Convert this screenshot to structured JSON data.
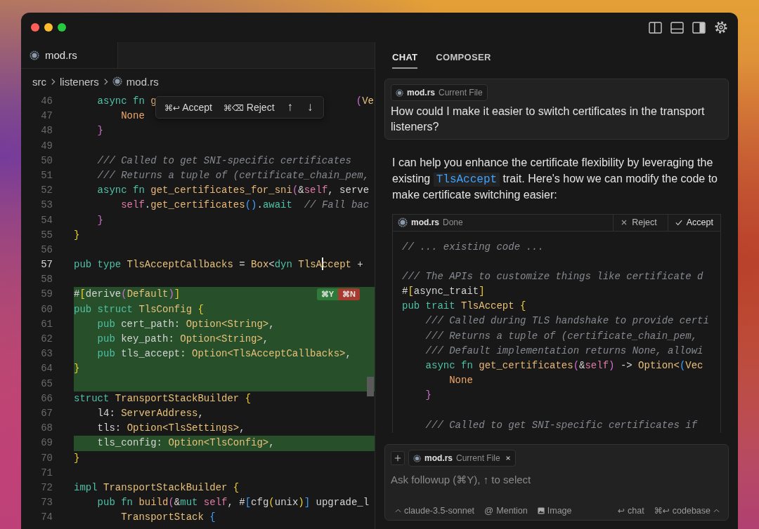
{
  "window": {
    "traffic_lights": [
      {
        "color": "#ff5f57"
      },
      {
        "color": "#febc2e"
      },
      {
        "color": "#28c840"
      }
    ]
  },
  "editor": {
    "tabs": [
      {
        "label": "mod.rs",
        "selected": true
      }
    ],
    "breadcrumb": [
      {
        "label": "src",
        "file": false
      },
      {
        "label": "listeners",
        "file": false
      },
      {
        "label": "mod.rs",
        "file": true
      }
    ],
    "popup": {
      "accept_keys": "⌘↩",
      "accept": "Accept",
      "reject_keys": "⌘⌫",
      "reject": "Reject",
      "previous": "↑",
      "next": "↓"
    },
    "lines": [
      {
        "n": "46",
        "added": false,
        "current": false,
        "tokens": [
          {
            "kind": "kw",
            "text": "    async fn"
          },
          {
            "kind": "fn",
            "text": " g"
          }
        ],
        "tail": [
          {
            "kind": "b2",
            "text": "("
          },
          {
            "kind": "type",
            "text": "Ve"
          }
        ]
      },
      {
        "n": "47",
        "added": false,
        "current": false,
        "tokens": [
          {
            "kind": "const",
            "text": "        None"
          }
        ]
      },
      {
        "n": "48",
        "added": false,
        "current": false,
        "tokens": [
          {
            "kind": "b2",
            "text": "    }"
          }
        ]
      },
      {
        "n": "49",
        "added": false,
        "current": false
      },
      {
        "n": "50",
        "added": false,
        "current": false,
        "tokens": [
          {
            "kind": "comment",
            "text": "    /// Called to get SNI-specific certificates"
          }
        ]
      },
      {
        "n": "51",
        "added": false,
        "current": false,
        "tokens": [
          {
            "kind": "comment",
            "text": "    /// Returns a tuple of (certificate_chain_pem,"
          }
        ]
      },
      {
        "n": "52",
        "added": false,
        "current": false,
        "tokens": [
          {
            "kind": "kw",
            "text": "    async fn"
          },
          {
            "kind": "fn",
            "text": " get_certificates_for_sni"
          },
          {
            "kind": "b2",
            "text": "("
          },
          {
            "kind": "p",
            "text": "&"
          },
          {
            "kind": "self",
            "text": "self"
          },
          {
            "kind": "p",
            "text": ", serve"
          }
        ]
      },
      {
        "n": "53",
        "added": false,
        "current": false,
        "tokens": [
          {
            "kind": "self",
            "text": "        self"
          },
          {
            "kind": "p",
            "text": "."
          },
          {
            "kind": "fn",
            "text": "get_certificates"
          },
          {
            "kind": "b3",
            "text": "()"
          },
          {
            "kind": "p",
            "text": "."
          },
          {
            "kind": "kw",
            "text": "await"
          },
          {
            "kind": "comment",
            "text": "  // Fall bac"
          }
        ]
      },
      {
        "n": "54",
        "added": false,
        "current": false,
        "tokens": [
          {
            "kind": "b2",
            "text": "    }"
          }
        ]
      },
      {
        "n": "55",
        "added": false,
        "current": false,
        "tokens": [
          {
            "kind": "b1",
            "text": "}"
          }
        ]
      },
      {
        "n": "56",
        "added": false,
        "current": false
      },
      {
        "n": "57",
        "added": false,
        "current": true,
        "tokens": [
          {
            "kind": "kw",
            "text": "pub type"
          },
          {
            "kind": "type",
            "text": " TlsAcceptCallbacks"
          },
          {
            "kind": "p",
            "text": " = "
          },
          {
            "kind": "type",
            "text": "Box"
          },
          {
            "kind": "p",
            "text": "<"
          },
          {
            "kind": "kw",
            "text": "dyn"
          },
          {
            "kind": "type",
            "text": " TlsA"
          },
          {
            "kind": "type",
            "text": "ccept",
            "cursor": true
          },
          {
            "kind": "p",
            "text": " +"
          }
        ]
      },
      {
        "n": "58",
        "added": false,
        "current": false
      },
      {
        "n": "59",
        "added": true,
        "current": false,
        "hunk_actions": {
          "accept": "⌘Y",
          "reject": "⌘N"
        },
        "tokens": [
          {
            "kind": "p",
            "text": "#"
          },
          {
            "kind": "b1",
            "text": "["
          },
          {
            "kind": "p",
            "text": "derive"
          },
          {
            "kind": "b2",
            "text": "("
          },
          {
            "kind": "type",
            "text": "Default"
          },
          {
            "kind": "b2",
            "text": ")"
          },
          {
            "kind": "b1",
            "text": "]"
          }
        ]
      },
      {
        "n": "60",
        "added": true,
        "current": false,
        "tokens": [
          {
            "kind": "kw",
            "text": "pub struct"
          },
          {
            "kind": "type",
            "text": " TlsConfig"
          },
          {
            "kind": "b1",
            "text": " {"
          }
        ]
      },
      {
        "n": "61",
        "added": true,
        "current": false,
        "tokens": [
          {
            "kind": "kw",
            "text": "    pub"
          },
          {
            "kind": "p",
            "text": " cert_path: "
          },
          {
            "kind": "type",
            "text": "Option<String>"
          },
          {
            "kind": "p",
            "text": ","
          }
        ]
      },
      {
        "n": "62",
        "added": true,
        "current": false,
        "tokens": [
          {
            "kind": "kw",
            "text": "    pub"
          },
          {
            "kind": "p",
            "text": " key_path: "
          },
          {
            "kind": "type",
            "text": "Option<String>"
          },
          {
            "kind": "p",
            "text": ","
          }
        ]
      },
      {
        "n": "63",
        "added": true,
        "current": false,
        "tokens": [
          {
            "kind": "kw",
            "text": "    pub"
          },
          {
            "kind": "p",
            "text": " tls_accept: "
          },
          {
            "kind": "type",
            "text": "Option<TlsAcceptCallbacks>"
          },
          {
            "kind": "p",
            "text": ","
          }
        ]
      },
      {
        "n": "64",
        "added": true,
        "current": false,
        "tokens": [
          {
            "kind": "b1",
            "text": "}"
          }
        ]
      },
      {
        "n": "65",
        "added": true,
        "current": false
      },
      {
        "n": "66",
        "added": false,
        "current": false,
        "tokens": [
          {
            "kind": "kw",
            "text": "struct"
          },
          {
            "kind": "type",
            "text": " TransportStackBuilder"
          },
          {
            "kind": "b1",
            "text": " {"
          }
        ]
      },
      {
        "n": "67",
        "added": false,
        "current": false,
        "tokens": [
          {
            "kind": "p",
            "text": "    l4: "
          },
          {
            "kind": "type",
            "text": "ServerAddress"
          },
          {
            "kind": "p",
            "text": ","
          }
        ]
      },
      {
        "n": "68",
        "added": false,
        "current": false,
        "tokens": [
          {
            "kind": "p",
            "text": "    tls: "
          },
          {
            "kind": "type",
            "text": "Option<TlsSettings>"
          },
          {
            "kind": "p",
            "text": ","
          }
        ]
      },
      {
        "n": "69",
        "added": true,
        "current": false,
        "tokens": [
          {
            "kind": "p",
            "text": "    tls_config: "
          },
          {
            "kind": "type",
            "text": "Option<TlsConfig>"
          },
          {
            "kind": "p",
            "text": ","
          }
        ]
      },
      {
        "n": "70",
        "added": false,
        "current": false,
        "tokens": [
          {
            "kind": "b1",
            "text": "}"
          }
        ]
      },
      {
        "n": "71",
        "added": false,
        "current": false
      },
      {
        "n": "72",
        "added": false,
        "current": false,
        "tokens": [
          {
            "kind": "kw",
            "text": "impl"
          },
          {
            "kind": "type",
            "text": " TransportStackBuilder"
          },
          {
            "kind": "b1",
            "text": " {"
          }
        ]
      },
      {
        "n": "73",
        "added": false,
        "current": false,
        "tokens": [
          {
            "kind": "kw",
            "text": "    pub fn"
          },
          {
            "kind": "fn",
            "text": " build"
          },
          {
            "kind": "b2",
            "text": "("
          },
          {
            "kind": "p",
            "text": "&"
          },
          {
            "kind": "kw",
            "text": "mut"
          },
          {
            "kind": "self",
            "text": " self"
          },
          {
            "kind": "p",
            "text": ", #"
          },
          {
            "kind": "b3",
            "text": "["
          },
          {
            "kind": "p",
            "text": "cfg"
          },
          {
            "kind": "b1",
            "text": "("
          },
          {
            "kind": "p",
            "text": "unix"
          },
          {
            "kind": "b1",
            "text": ")"
          },
          {
            "kind": "b3",
            "text": "]"
          },
          {
            "kind": "p",
            "text": " upgrade_l"
          }
        ]
      },
      {
        "n": "74",
        "added": false,
        "current": false,
        "tokens": [
          {
            "kind": "type",
            "text": "        TransportStack"
          },
          {
            "kind": "b3",
            "text": " {"
          }
        ]
      }
    ]
  },
  "side": {
    "tabs": [
      {
        "label": "CHAT",
        "selected": true
      },
      {
        "label": "COMPOSER",
        "selected": false
      }
    ],
    "question": {
      "chip": {
        "file": "mod.rs",
        "note": "Current File"
      },
      "text": "How could I make it easier to switch certificates in the transport listeners?"
    },
    "answer": [
      {
        "kind": "text",
        "text": "I can help you enhance the certificate flexibility by leveraging the existing "
      },
      {
        "kind": "code",
        "text": "TlsAccept"
      },
      {
        "kind": "text",
        "text": " trait. Here's how we can modify the code to make certificate switching easier:"
      }
    ],
    "code_block": {
      "file": "mod.rs",
      "status": "Done",
      "reject": "Reject",
      "accept": "Accept",
      "lines": [
        {
          "kind": "code",
          "tokens": [
            {
              "kind": "comment",
              "text": "// ... existing code ..."
            }
          ]
        },
        {
          "kind": "blank"
        },
        {
          "kind": "code",
          "tokens": [
            {
              "kind": "comment",
              "text": "/// The APIs to customize things like certificate d"
            }
          ]
        },
        {
          "kind": "code",
          "tokens": [
            {
              "kind": "p",
              "text": "#"
            },
            {
              "kind": "b1",
              "text": "["
            },
            {
              "kind": "p",
              "text": "async_trait"
            },
            {
              "kind": "b1",
              "text": "]"
            }
          ]
        },
        {
          "kind": "code",
          "tokens": [
            {
              "kind": "kw",
              "text": "pub trait"
            },
            {
              "kind": "type",
              "text": " TlsAccept"
            },
            {
              "kind": "b1",
              "text": " {"
            }
          ]
        },
        {
          "kind": "code",
          "tokens": [
            {
              "kind": "comment",
              "text": "    /// Called during TLS handshake to provide certi"
            }
          ]
        },
        {
          "kind": "code",
          "tokens": [
            {
              "kind": "comment",
              "text": "    /// Returns a tuple of (certificate_chain_pem,"
            }
          ]
        },
        {
          "kind": "code",
          "tokens": [
            {
              "kind": "comment",
              "text": "    /// Default implementation returns None, allowi"
            }
          ]
        },
        {
          "kind": "code",
          "tokens": [
            {
              "kind": "kw",
              "text": "    async fn"
            },
            {
              "kind": "fn",
              "text": " get_certificates"
            },
            {
              "kind": "b2",
              "text": "("
            },
            {
              "kind": "p",
              "text": "&"
            },
            {
              "kind": "self",
              "text": "self"
            },
            {
              "kind": "b2",
              "text": ")"
            },
            {
              "kind": "p",
              "text": " -> "
            },
            {
              "kind": "type",
              "text": "Option<"
            },
            {
              "kind": "b3",
              "text": "("
            },
            {
              "kind": "type",
              "text": "Vec"
            }
          ]
        },
        {
          "kind": "code",
          "tokens": [
            {
              "kind": "const",
              "text": "        None"
            }
          ]
        },
        {
          "kind": "code",
          "tokens": [
            {
              "kind": "b2",
              "text": "    }"
            }
          ]
        },
        {
          "kind": "blank"
        },
        {
          "kind": "code",
          "tokens": [
            {
              "kind": "comment",
              "text": "    /// Called to get SNI-specific certificates if"
            }
          ]
        }
      ]
    },
    "composer": {
      "chip": {
        "file": "mod.rs",
        "note": "Current File"
      },
      "placeholder": "Ask followup (⌘Y), ↑ to select",
      "model": "claude-3.5-sonnet",
      "mention_symbol": "@",
      "mention": "Mention",
      "image": "Image",
      "chat_keys": "↩",
      "chat": "chat",
      "codebase_keys": "⌘↩",
      "codebase": "codebase"
    }
  }
}
